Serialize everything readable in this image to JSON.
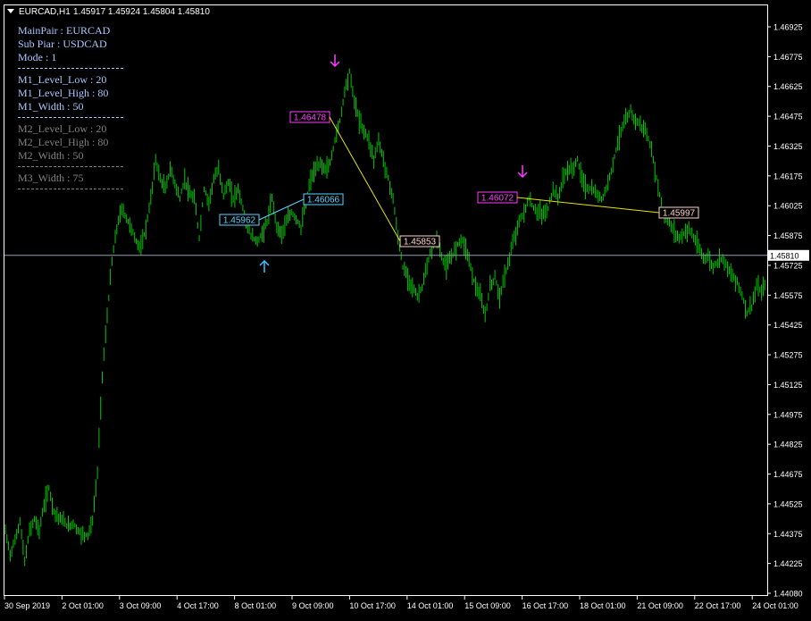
{
  "header": {
    "symbol": "EURCAD,H1",
    "ohlc": "1.45917 1.45924 1.45804 1.45810"
  },
  "info_panel": {
    "main_pair": "MainPair : EURCAD",
    "sub_pair": "Sub Piar : USDCAD",
    "mode": "Mode : 1",
    "m1_low": "M1_Level_Low : 20",
    "m1_high": "M1_Level_High : 80",
    "m1_width": "M1_Width : 50",
    "m2_low": "M2_Level_Low : 20",
    "m2_high": "M2_Level_High : 80",
    "m2_width": "M2_Width : 50",
    "m3_width": "M3_Width : 75"
  },
  "colors": {
    "background": "#000000",
    "candles": "#00c800",
    "axis": "#ffffff",
    "grid_line": "#8fa0b4",
    "info_active": "#a8c8ff",
    "info_inactive": "#808080",
    "swing_line": "#e6e600",
    "high_label": "#ff3cff",
    "low_label": "#5ad2ff",
    "mid_label": "#ffd2c8",
    "arrow_down": "#ff3cff",
    "arrow_up": "#32c8ff"
  },
  "chart_data": {
    "type": "line",
    "yticks": [
      "1.46925",
      "1.46775",
      "1.46625",
      "1.46475",
      "1.46325",
      "1.46175",
      "1.46025",
      "1.45875",
      "1.45725",
      "1.45575",
      "1.45425",
      "1.45275",
      "1.45125",
      "1.44975",
      "1.44825",
      "1.44675",
      "1.44525",
      "1.44375",
      "1.44225",
      "1.44080"
    ],
    "ylim": [
      1.4408,
      1.4698
    ],
    "current_price": "1.45810",
    "current_price_value": 1.4581,
    "xticks": [
      "30 Sep 2019",
      "2 Oct 01:00",
      "3 Oct 09:00",
      "4 Oct 17:00",
      "8 Oct 01:00",
      "9 Oct 09:00",
      "10 Oct 17:00",
      "14 Oct 01:00",
      "15 Oct 09:00",
      "16 Oct 17:00",
      "18 Oct 01:00",
      "21 Oct 09:00",
      "22 Oct 17:00",
      "24 Oct 01:00"
    ],
    "series": [
      {
        "values": [
          1.444,
          1.4428,
          1.4435,
          1.4445,
          1.4424,
          1.444,
          1.4446,
          1.444,
          1.4453,
          1.4462,
          1.445,
          1.4447,
          1.4445,
          1.4442,
          1.4444,
          1.444,
          1.4438,
          1.4438,
          1.4445,
          1.447,
          1.452,
          1.455,
          1.4578,
          1.4595,
          1.4605,
          1.46,
          1.4595,
          1.4588,
          1.4585,
          1.4595,
          1.461,
          1.463,
          1.462,
          1.4615,
          1.4625,
          1.4618,
          1.461,
          1.462,
          1.4612,
          1.461,
          1.459,
          1.4615,
          1.4608,
          1.462,
          1.4625,
          1.4612,
          1.4618,
          1.461,
          1.4615,
          1.4605,
          1.4595,
          1.459,
          1.4588,
          1.4592,
          1.4598,
          1.461,
          1.4596,
          1.4592,
          1.4598,
          1.4603,
          1.46,
          1.4595,
          1.4608,
          1.462,
          1.4625,
          1.4628,
          1.4625,
          1.4628,
          1.464,
          1.465,
          1.4665,
          1.4675,
          1.466,
          1.465,
          1.4645,
          1.464,
          1.463,
          1.464,
          1.463,
          1.462,
          1.461,
          1.459,
          1.4575,
          1.457,
          1.4565,
          1.456,
          1.4565,
          1.4575,
          1.4585,
          1.459,
          1.458,
          1.4575,
          1.458,
          1.4585,
          1.459,
          1.4585,
          1.4575,
          1.4565,
          1.456,
          1.455,
          1.4565,
          1.457,
          1.456,
          1.457,
          1.458,
          1.459,
          1.4598,
          1.4603,
          1.461,
          1.4605,
          1.4603,
          1.4602,
          1.4605,
          1.4615,
          1.461,
          1.462,
          1.4625,
          1.4625,
          1.463,
          1.462,
          1.4615,
          1.4615,
          1.4612,
          1.461,
          1.4615,
          1.4625,
          1.4635,
          1.4645,
          1.465,
          1.4655,
          1.465,
          1.4648,
          1.4645,
          1.4638,
          1.4625,
          1.4612,
          1.46,
          1.4598,
          1.4593,
          1.459,
          1.4592,
          1.4595,
          1.459,
          1.4585,
          1.458,
          1.458,
          1.4575,
          1.4578,
          1.458,
          1.4575,
          1.457,
          1.4568,
          1.456,
          1.4552,
          1.4555,
          1.4565,
          1.4562,
          1.4568
        ]
      }
    ],
    "swing_labels": [
      {
        "text": "1.45962",
        "price": 1.4596,
        "kind": "low"
      },
      {
        "text": "1.46066",
        "price": 1.46066,
        "kind": "low"
      },
      {
        "text": "1.46478",
        "price": 1.46478,
        "kind": "high"
      },
      {
        "text": "1.45853",
        "price": 1.45853,
        "kind": "mid"
      },
      {
        "text": "1.46072",
        "price": 1.46072,
        "kind": "high"
      },
      {
        "text": "1.45997",
        "price": 1.45997,
        "kind": "mid"
      }
    ]
  }
}
